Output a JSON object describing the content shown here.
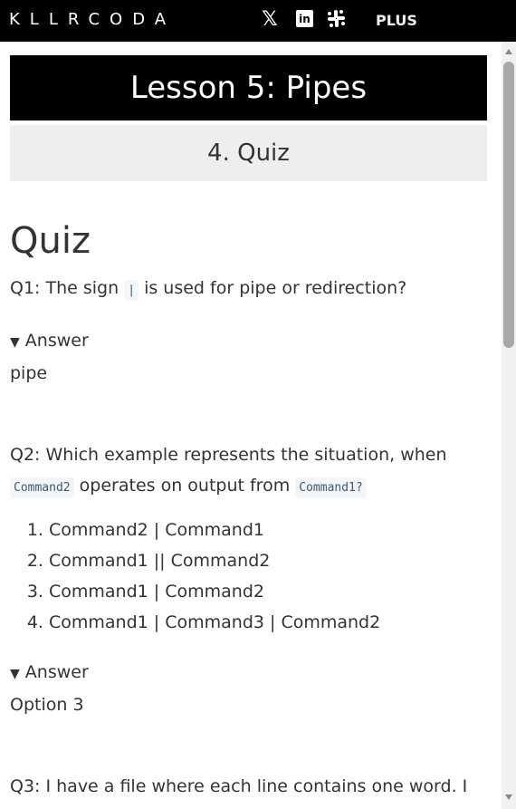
{
  "topbar": {
    "logo": "KLLRCODA",
    "social_icons": [
      "x-icon",
      "linkedin-icon",
      "slack-icon"
    ],
    "linkedin_glyph": "in",
    "x_glyph": "𝕏",
    "plus_label": "PLUS"
  },
  "lesson": {
    "title": "Lesson 5: Pipes",
    "step_title": "4. Quiz"
  },
  "quiz": {
    "heading": "Quiz",
    "q1": {
      "prefix": "Q1: The sign",
      "code": "|",
      "suffix": "is used for pipe or redirection?",
      "answer_label": "Answer",
      "answer": "pipe"
    },
    "q2": {
      "prefix": "Q2: Which example represents the situation, when",
      "code1": "Command2",
      "middle": "operates on output from",
      "code2": "Command1?",
      "options": [
        "Command2 | Command1",
        "Command1 || Command2",
        "Command1 | Command2",
        "Command1 | Command3 | Command2"
      ],
      "answer_label": "Answer",
      "answer": "Option 3"
    },
    "q3": {
      "text": "Q3: I have a file where each line contains one word. I"
    }
  },
  "colors": {
    "topbar_bg": "#000000",
    "lesson_title_bg": "#000000",
    "step_title_bg": "#eeeeee",
    "text": "#333333"
  }
}
